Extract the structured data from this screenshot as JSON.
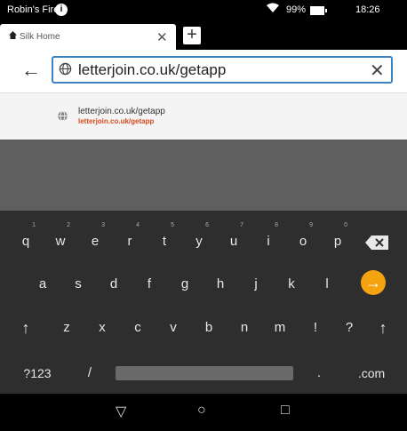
{
  "status_bar": {
    "device_name": "Robin's Fire",
    "info_icon": "i",
    "battery": "99%",
    "time": "18:26"
  },
  "tabs": [
    {
      "title": "Silk Home"
    }
  ],
  "address_bar": {
    "value": "letterjoin.co.uk/getapp"
  },
  "suggestion": {
    "title": "letterjoin.co.uk/getapp",
    "url": "letterjoin.co.uk/getapp"
  },
  "keyboard": {
    "row1": [
      {
        "key": "q",
        "hint": "1"
      },
      {
        "key": "w",
        "hint": "2"
      },
      {
        "key": "e",
        "hint": "3"
      },
      {
        "key": "r",
        "hint": "4"
      },
      {
        "key": "t",
        "hint": "5"
      },
      {
        "key": "y",
        "hint": "6"
      },
      {
        "key": "u",
        "hint": "7"
      },
      {
        "key": "i",
        "hint": "8"
      },
      {
        "key": "o",
        "hint": "9"
      },
      {
        "key": "p",
        "hint": "0"
      }
    ],
    "row2": [
      "a",
      "s",
      "d",
      "f",
      "g",
      "h",
      "j",
      "k",
      "l"
    ],
    "row3": [
      "z",
      "x",
      "c",
      "v",
      "b",
      "n",
      "m",
      "!",
      "?"
    ],
    "shift_label": "↑",
    "symbols_label": "?123",
    "slash_label": "/",
    "period_label": ".",
    "com_label": ".com",
    "enter_label": "→",
    "accent_color": "#f5a30f"
  },
  "nav_bar": {
    "back": "▽",
    "home": "○",
    "recents": "□"
  }
}
